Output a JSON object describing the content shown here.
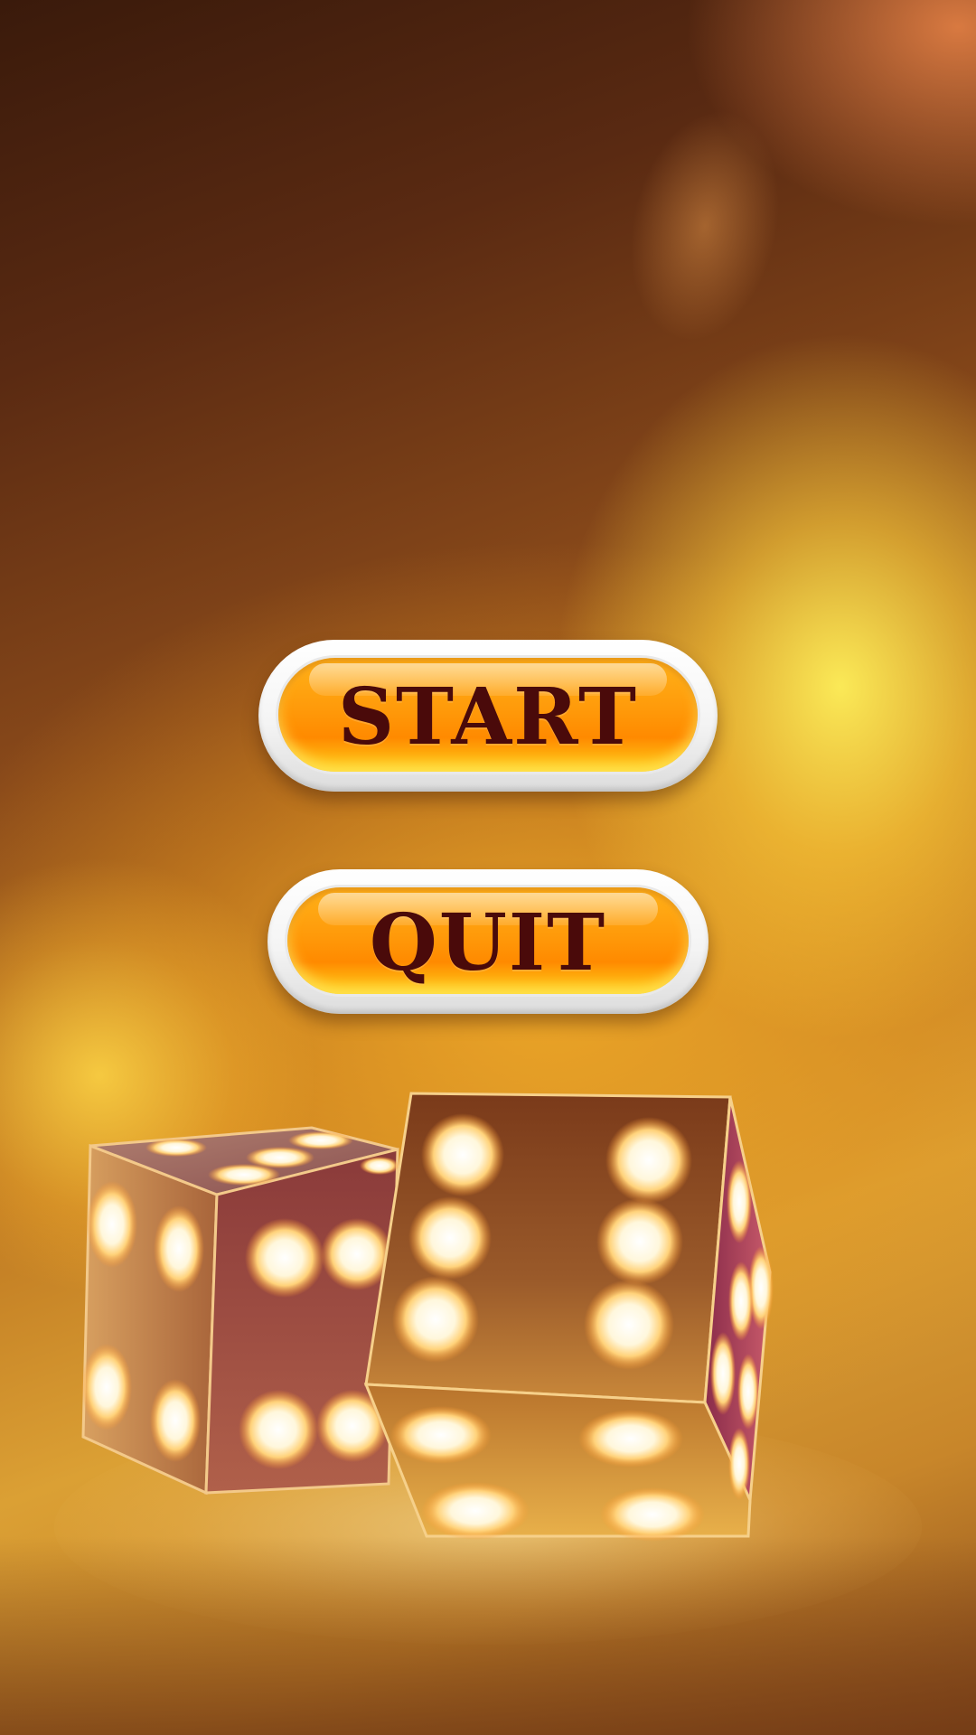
{
  "menu": {
    "start_label": "START",
    "quit_label": "QUIT"
  },
  "colors": {
    "button_fill": "#ff9a0a",
    "button_text": "#4a0a0a",
    "button_frame": "#ffffff",
    "pip_glow": "#fff6d8"
  },
  "dice": {
    "left_die": {
      "top_face_pips": 5,
      "left_face_pips": 4,
      "front_face_pips": 4
    },
    "right_die": {
      "front_face_pips": 6,
      "bottom_face_pips": 4,
      "side_face_pips": 6
    }
  }
}
